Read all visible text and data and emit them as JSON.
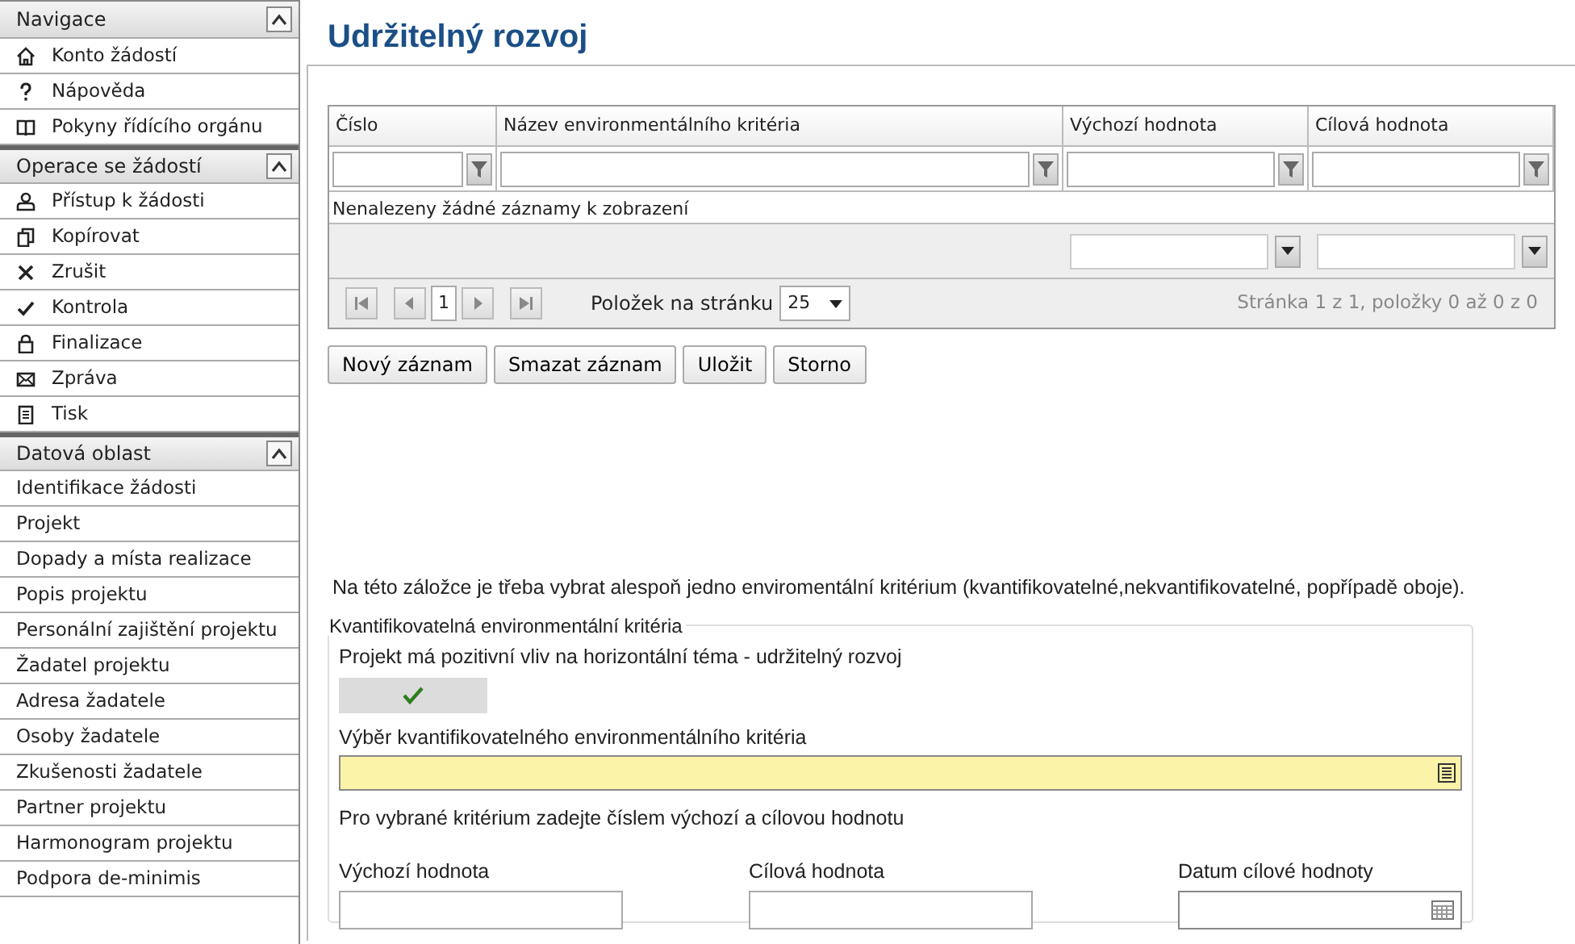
{
  "sidebar": [
    {
      "title": "Navigace",
      "expanded": true,
      "items": [
        {
          "label": "Konto žádostí"
        },
        {
          "label": "Nápověda"
        },
        {
          "label": "Pokyny řídícího orgánu"
        }
      ]
    },
    {
      "title": "Operace se žádostí",
      "expanded": true,
      "items": [
        {
          "label": "Přístup k žádosti"
        },
        {
          "label": "Kopírovat"
        },
        {
          "label": "Zrušit"
        },
        {
          "label": "Kontrola"
        },
        {
          "label": "Finalizace"
        },
        {
          "label": "Zpráva"
        },
        {
          "label": "Tisk"
        }
      ]
    },
    {
      "title": "Datová oblast",
      "expanded": true,
      "items": [
        {
          "label": "Identifikace žádosti"
        },
        {
          "label": "Projekt"
        },
        {
          "label": "Dopady a místa realizace"
        },
        {
          "label": "Popis projektu"
        },
        {
          "label": "Personální zajištění projektu"
        },
        {
          "label": "Žadatel projektu"
        },
        {
          "label": "Adresa žadatele"
        },
        {
          "label": "Osoby žadatele"
        },
        {
          "label": "Zkušenosti žadatele"
        },
        {
          "label": "Partner projektu"
        },
        {
          "label": "Harmonogram projektu"
        },
        {
          "label": "Podpora de-minimis"
        }
      ]
    }
  ],
  "page_title": "Udržitelný rozvoj",
  "grid": {
    "columns": [
      "Číslo",
      "Název environmentálního kritéria",
      "Výchozí hodnota",
      "Cílová hodnota"
    ],
    "empty_message": "Nenalezeny žádné záznamy k zobrazení",
    "pager": {
      "page": "1",
      "page_size_label": "Položek na stránku",
      "page_size": "25",
      "summary": "Stránka 1 z 1, položky 0 až 0 z 0"
    }
  },
  "buttons": [
    "Nový záznam",
    "Smazat záznam",
    "Uložit",
    "Storno"
  ],
  "note": "Na této záložce je třeba vybrat alespoň jedno enviromentální kritérium (kvantifikovatelné,nekvantifikovatelné, popřípadě oboje).",
  "fieldset": {
    "legend": "Kvantifikovatelná environmentální kritéria",
    "positive_label": "Projekt má pozitivní vliv na horizontální téma - udržitelný rozvoj",
    "positive_checked": true,
    "criterion_label": "Výběr kvantifikovatelného environmentálního kritéria",
    "hint": "Pro vybrané kritérium zadejte číslem výchozí a cílovou hodnotu",
    "fields": [
      {
        "kind": "text",
        "label": "Výchozí hodnota"
      },
      {
        "kind": "text",
        "label": "Cílová hodnota"
      },
      {
        "kind": "date",
        "label": "Datum cílové hodnoty"
      }
    ]
  }
}
